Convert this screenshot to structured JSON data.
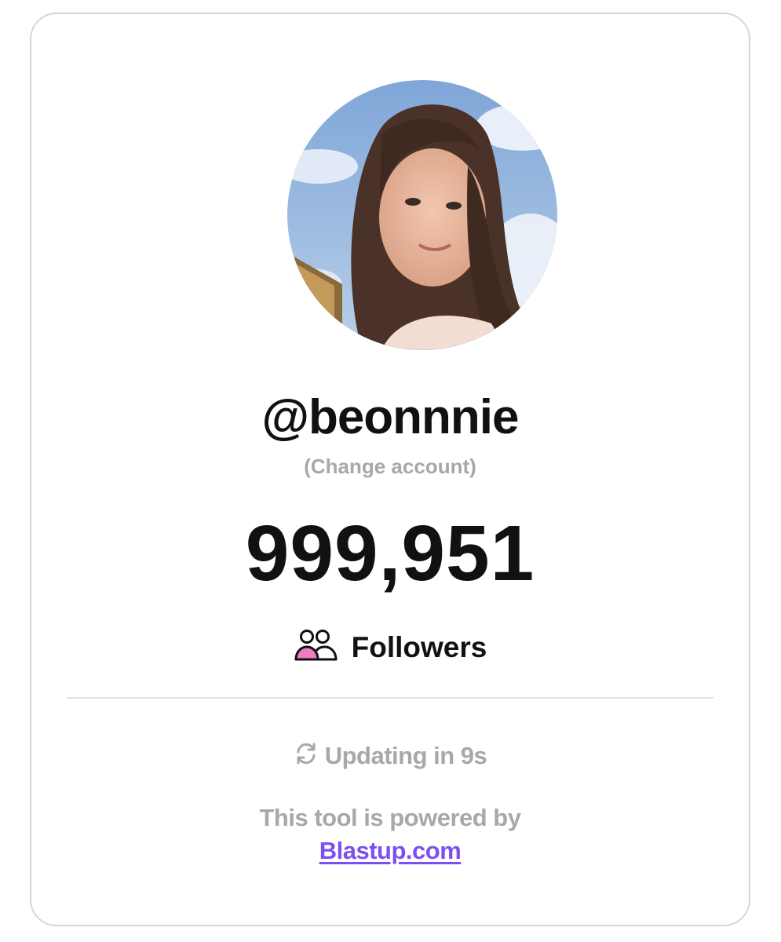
{
  "profile": {
    "username": "@beonnnie",
    "change_account_label": "(Change account)",
    "avatar_icon": "profile-photo"
  },
  "stats": {
    "follower_count": "999,951",
    "followers_label": "Followers",
    "followers_icon": "users-icon"
  },
  "status": {
    "updating_text": "Updating in 9s",
    "updating_icon": "refresh-icon"
  },
  "footer": {
    "powered_by_text": "This tool is powered by",
    "link_label": "Blastup.com"
  },
  "colors": {
    "text_primary": "#111111",
    "text_muted": "#a8a8a8",
    "link": "#7b4ff0",
    "icon_accent": "#f07ac4",
    "border": "#d6d6d6"
  }
}
